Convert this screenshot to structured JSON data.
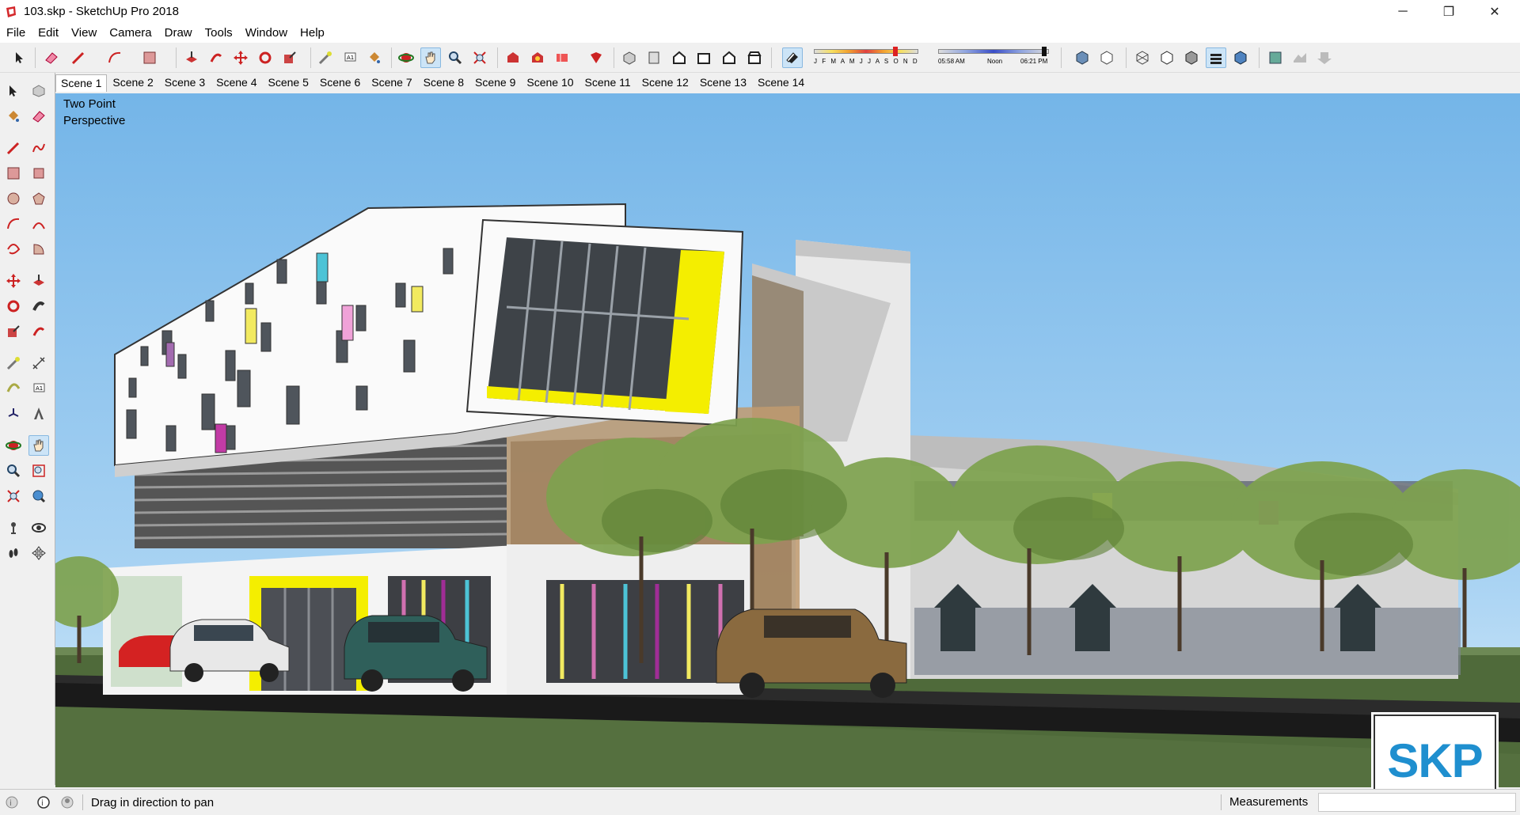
{
  "window": {
    "title": "103.skp - SketchUp Pro 2018",
    "controls": [
      "─",
      "❐",
      "✕"
    ]
  },
  "menu": [
    "File",
    "Edit",
    "View",
    "Camera",
    "Draw",
    "Tools",
    "Window",
    "Help"
  ],
  "shadow_settings": {
    "months": "J F M A M J J A S O N D",
    "time_start": "05:58 AM",
    "time_mid": "Noon",
    "time_end": "06:21 PM"
  },
  "scenes": [
    "Scene 1",
    "Scene 2",
    "Scene 3",
    "Scene 4",
    "Scene 5",
    "Scene 6",
    "Scene 7",
    "Scene 8",
    "Scene 9",
    "Scene 10",
    "Scene 11",
    "Scene 12",
    "Scene 13",
    "Scene 14"
  ],
  "active_scene": "Scene 1",
  "viewport": {
    "camera_line1": "Two Point",
    "camera_line2": "Perspective"
  },
  "status": {
    "hint": "Drag in direction to pan",
    "measurements_label": "Measurements",
    "measurements_value": ""
  },
  "watermark": "SKP",
  "colors": {
    "sky": "#79b9ea",
    "accent_yellow": "#f4ee00",
    "logo_blue": "#1f8fcf"
  }
}
